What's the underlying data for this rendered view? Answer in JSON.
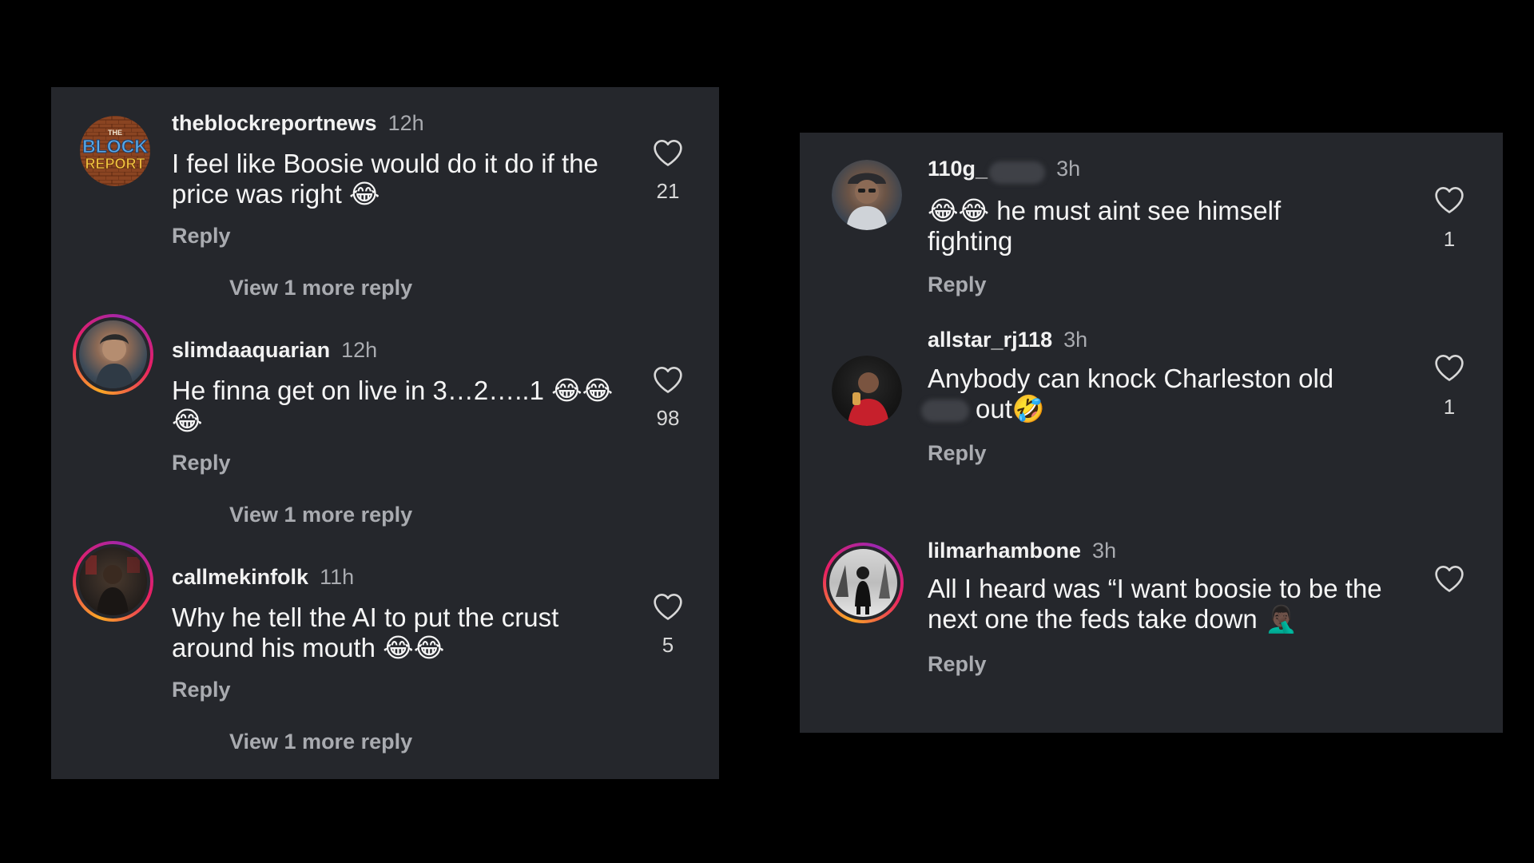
{
  "left_panel": {
    "comments": [
      {
        "username": "theblockreportnews",
        "time": "12h",
        "text": "I feel like Boosie would do it do if the price was right 😂",
        "likes": "21",
        "reply_label": "Reply",
        "more_replies": "View 1 more reply",
        "avatar_logo": {
          "top": "THE",
          "mid": "BLOCK",
          "bottom": "REPORT"
        }
      },
      {
        "username": "slimdaaquarian",
        "time": "12h",
        "text": "He finna get on live in 3…2…..1 😂😂😂",
        "likes": "98",
        "reply_label": "Reply",
        "more_replies": "View 1 more reply"
      },
      {
        "username": "callmekinfolk",
        "time": "11h",
        "text": "Why he tell the AI to put the crust around his mouth 😂😂",
        "likes": "5",
        "reply_label": "Reply",
        "more_replies": "View 1 more reply"
      }
    ]
  },
  "right_panel": {
    "comments": [
      {
        "username": "110g_",
        "time": "3h",
        "text": "😂😂 he must aint see himself fighting",
        "likes": "1",
        "reply_label": "Reply"
      },
      {
        "username": "allstar_rj118",
        "time": "3h",
        "text": "Anybody can knock Charleston old",
        "text_tail": "out🤣",
        "likes": "1",
        "reply_label": "Reply"
      },
      {
        "username": "lilmarhambone",
        "time": "3h",
        "text": "All I heard was “I want boosie to be the next one the feds take down 🤦🏿‍♂️",
        "reply_label": "Reply"
      }
    ]
  },
  "colors": {
    "background": "#000000",
    "panel": "#25272c",
    "primary_text": "#f5f5f5",
    "secondary_text": "#a9abb0",
    "story_ring": [
      "#f9a825",
      "#e91e63",
      "#9c27b0"
    ]
  },
  "icons": {
    "like": "heart-outline-icon"
  }
}
